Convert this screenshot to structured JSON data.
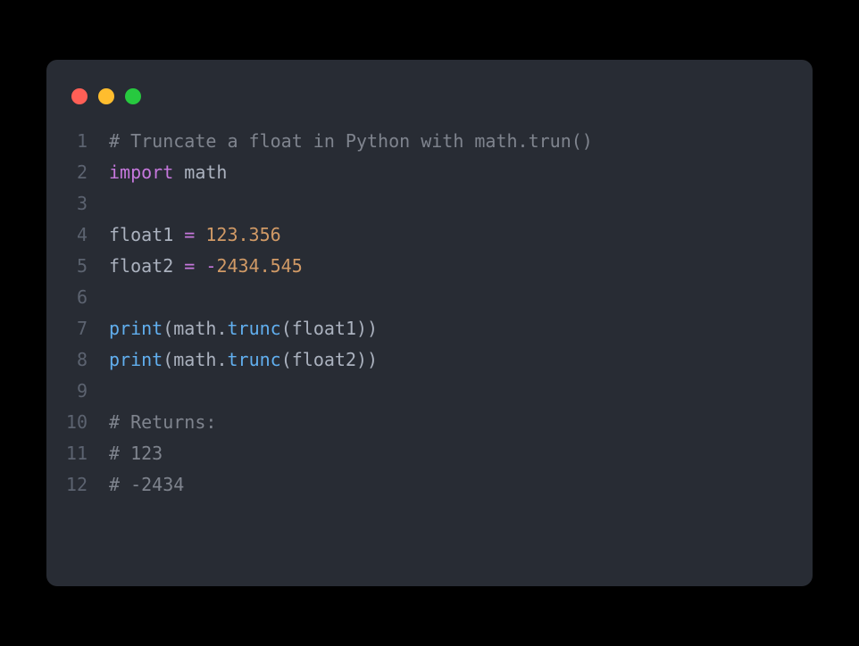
{
  "code": {
    "lines": [
      {
        "num": "1",
        "tokens": [
          {
            "cls": "tok-comment",
            "text": "# Truncate a float in Python with math.trun()"
          }
        ]
      },
      {
        "num": "2",
        "tokens": [
          {
            "cls": "tok-keyword",
            "text": "import"
          },
          {
            "cls": "tok-module",
            "text": " math"
          }
        ]
      },
      {
        "num": "3",
        "tokens": []
      },
      {
        "num": "4",
        "tokens": [
          {
            "cls": "tok-variable",
            "text": "float1 "
          },
          {
            "cls": "tok-operator",
            "text": "="
          },
          {
            "cls": "tok-variable",
            "text": " "
          },
          {
            "cls": "tok-number",
            "text": "123.356"
          }
        ]
      },
      {
        "num": "5",
        "tokens": [
          {
            "cls": "tok-variable",
            "text": "float2 "
          },
          {
            "cls": "tok-operator",
            "text": "="
          },
          {
            "cls": "tok-variable",
            "text": " "
          },
          {
            "cls": "tok-minus",
            "text": "-"
          },
          {
            "cls": "tok-number",
            "text": "2434.545"
          }
        ]
      },
      {
        "num": "6",
        "tokens": []
      },
      {
        "num": "7",
        "tokens": [
          {
            "cls": "tok-function",
            "text": "print"
          },
          {
            "cls": "tok-punct",
            "text": "("
          },
          {
            "cls": "tok-variable",
            "text": "math"
          },
          {
            "cls": "tok-punct",
            "text": "."
          },
          {
            "cls": "tok-function",
            "text": "trunc"
          },
          {
            "cls": "tok-punct",
            "text": "("
          },
          {
            "cls": "tok-variable",
            "text": "float1"
          },
          {
            "cls": "tok-punct",
            "text": "))"
          }
        ]
      },
      {
        "num": "8",
        "tokens": [
          {
            "cls": "tok-function",
            "text": "print"
          },
          {
            "cls": "tok-punct",
            "text": "("
          },
          {
            "cls": "tok-variable",
            "text": "math"
          },
          {
            "cls": "tok-punct",
            "text": "."
          },
          {
            "cls": "tok-function",
            "text": "trunc"
          },
          {
            "cls": "tok-punct",
            "text": "("
          },
          {
            "cls": "tok-variable",
            "text": "float2"
          },
          {
            "cls": "tok-punct",
            "text": "))"
          }
        ]
      },
      {
        "num": "9",
        "tokens": []
      },
      {
        "num": "10",
        "tokens": [
          {
            "cls": "tok-comment",
            "text": "# Returns:"
          }
        ]
      },
      {
        "num": "11",
        "tokens": [
          {
            "cls": "tok-comment",
            "text": "# 123"
          }
        ]
      },
      {
        "num": "12",
        "tokens": [
          {
            "cls": "tok-comment",
            "text": "# -2434"
          }
        ]
      }
    ]
  }
}
